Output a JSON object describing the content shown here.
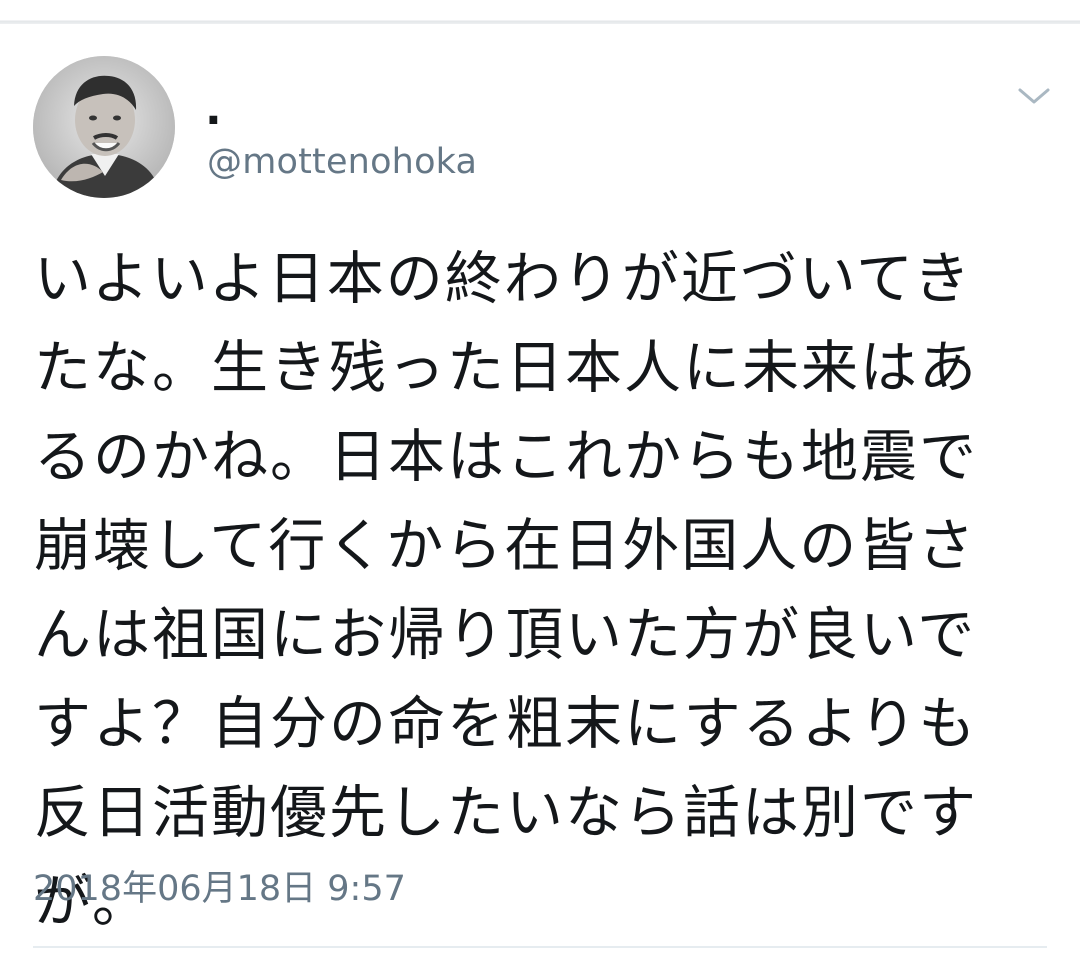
{
  "tweet": {
    "display_name": ".",
    "handle": "@mottenohoka",
    "text": "いよいよ日本の終わりが近づいてき\nたな。生き残った日本人に未来はあ\nるのかね。日本はこれからも地震で\n崩壊して行くから在日外国人の皆さ\nんは祖国にお帰り頂いた方が良いで\nすよ？自分の命を粗末にするよりも\n反日活動優先したいなら話は別です\nが。",
    "timestamp": "2018年06月18日 9:57",
    "avatar_icon": "user-avatar-photo",
    "menu_icon": "chevron-down-icon"
  },
  "colors": {
    "text_primary": "#14171a",
    "text_secondary": "#657786",
    "divider": "#e6ecf0",
    "chevron": "#aab8c2"
  }
}
